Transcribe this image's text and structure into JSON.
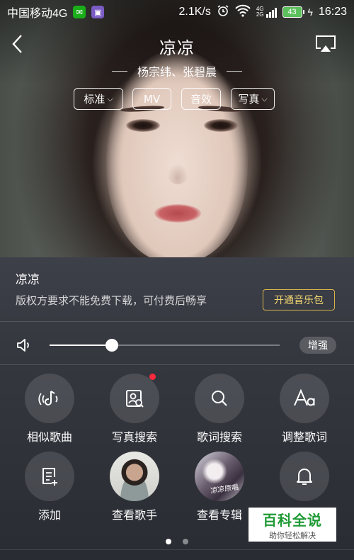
{
  "status_bar": {
    "carrier": "中国移动4G",
    "net_speed": "2.1K/s",
    "network_type": "4G 2G",
    "battery": "43",
    "time": "16:23"
  },
  "header": {
    "title": "凉凉",
    "artists": "杨宗纬、张碧晨",
    "chips": [
      {
        "label": "标准",
        "has_caret": true
      },
      {
        "label": "MV",
        "has_caret": false
      },
      {
        "label": "音效",
        "has_caret": false
      },
      {
        "label": "写真",
        "has_caret": true
      }
    ]
  },
  "song_info": {
    "name": "凉凉",
    "notice": "版权方要求不能免费下载，可付费后畅享",
    "open_button": "开通音乐包"
  },
  "volume": {
    "level": 0.27,
    "boost_label": "增强"
  },
  "actions": [
    {
      "label": "相似歌曲",
      "icon": "similar-songs-icon"
    },
    {
      "label": "写真搜索",
      "icon": "photo-search-icon",
      "badge": true
    },
    {
      "label": "歌词搜索",
      "icon": "search-icon"
    },
    {
      "label": "调整歌词",
      "icon": "font-size-icon"
    },
    {
      "label": "添加",
      "icon": "add-playlist-icon"
    },
    {
      "label": "查看歌手",
      "icon": "singer-avatar"
    },
    {
      "label": "查看专辑",
      "icon": "album-cover"
    },
    {
      "label": "",
      "icon": "bell-icon"
    }
  ],
  "album_cover_text": "凉凉原唱",
  "pager": {
    "pages": 2,
    "current": 1
  },
  "watermark": {
    "title": "百科全说",
    "subtitle": "助你轻松解决"
  },
  "colors": {
    "accent_gold": "#d8b64a",
    "badge_red": "#ff2a3d",
    "panel_bg": "#35383f"
  }
}
